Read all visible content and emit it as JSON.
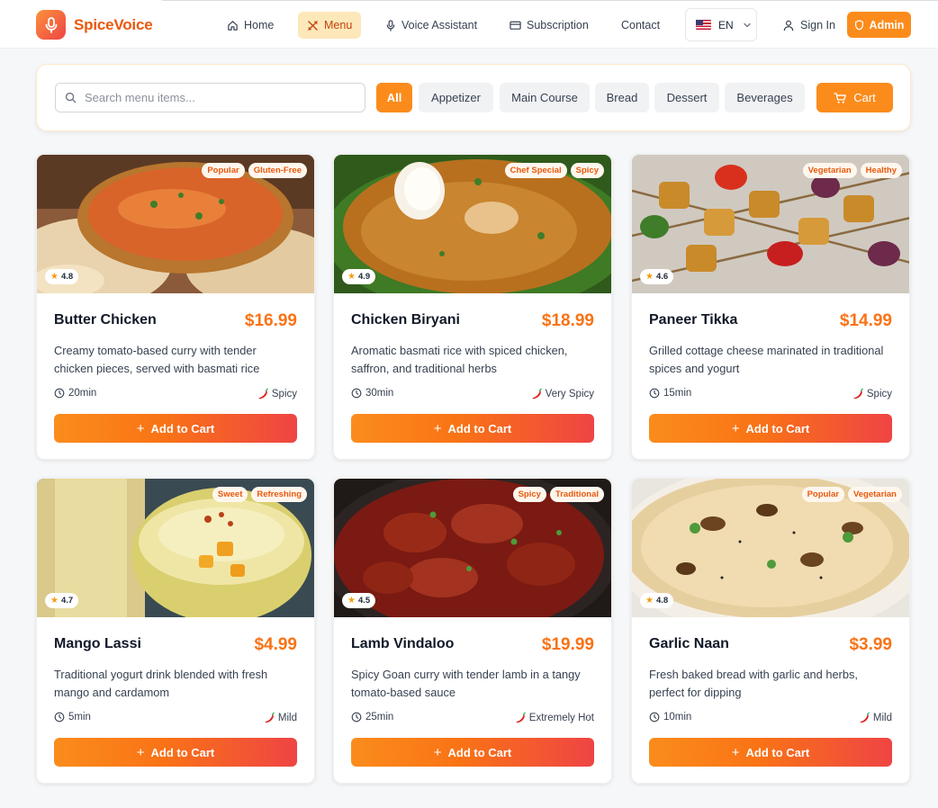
{
  "brand": {
    "name": "SpiceVoice",
    "logo_icon": "microphone-icon"
  },
  "nav": {
    "items": [
      {
        "label": "Home",
        "icon": "home-icon"
      },
      {
        "label": "Menu",
        "icon": "utensils-icon",
        "active": true
      },
      {
        "label": "Voice Assistant",
        "icon": "microphone-icon"
      },
      {
        "label": "Subscription",
        "icon": "credit-card-icon"
      },
      {
        "label": "Contact"
      }
    ],
    "language": "EN",
    "sign_in": "Sign In",
    "admin": "Admin"
  },
  "filters": {
    "search_placeholder": "Search menu items...",
    "search_value": "",
    "categories": [
      "All",
      "Appetizer",
      "Main Course",
      "Bread",
      "Dessert",
      "Beverages"
    ],
    "active_category": "All",
    "cart_label": "Cart"
  },
  "colors": {
    "accent": "#fb8c1c",
    "price": "#f97316",
    "gradient_end": "#ef4444",
    "tag_text": "#e8590c"
  },
  "menu_items": [
    {
      "name": "Butter Chicken",
      "price": "$16.99",
      "description": "Creamy tomato-based curry with tender chicken pieces, served with basmati rice",
      "tags": [
        "Popular",
        "Gluten-Free"
      ],
      "rating": "4.8",
      "time": "20min",
      "spice": "Spicy",
      "button": "Add to Cart"
    },
    {
      "name": "Chicken Biryani",
      "price": "$18.99",
      "description": "Aromatic basmati rice with spiced chicken, saffron, and traditional herbs",
      "tags": [
        "Chef Special",
        "Spicy"
      ],
      "rating": "4.9",
      "time": "30min",
      "spice": "Very Spicy",
      "button": "Add to Cart"
    },
    {
      "name": "Paneer Tikka",
      "price": "$14.99",
      "description": "Grilled cottage cheese marinated in traditional spices and yogurt",
      "tags": [
        "Vegetarian",
        "Healthy"
      ],
      "rating": "4.6",
      "time": "15min",
      "spice": "Spicy",
      "button": "Add to Cart"
    },
    {
      "name": "Mango Lassi",
      "price": "$4.99",
      "description": "Traditional yogurt drink blended with fresh mango and cardamom",
      "tags": [
        "Sweet",
        "Refreshing"
      ],
      "rating": "4.7",
      "time": "5min",
      "spice": "Mild",
      "button": "Add to Cart"
    },
    {
      "name": "Lamb Vindaloo",
      "price": "$19.99",
      "description": "Spicy Goan curry with tender lamb in a tangy tomato-based sauce",
      "tags": [
        "Spicy",
        "Traditional"
      ],
      "rating": "4.5",
      "time": "25min",
      "spice": "Extremely Hot",
      "button": "Add to Cart"
    },
    {
      "name": "Garlic Naan",
      "price": "$3.99",
      "description": "Fresh baked bread with garlic and herbs, perfect for dipping",
      "tags": [
        "Popular",
        "Vegetarian"
      ],
      "rating": "4.8",
      "time": "10min",
      "spice": "Mild",
      "button": "Add to Cart"
    }
  ]
}
